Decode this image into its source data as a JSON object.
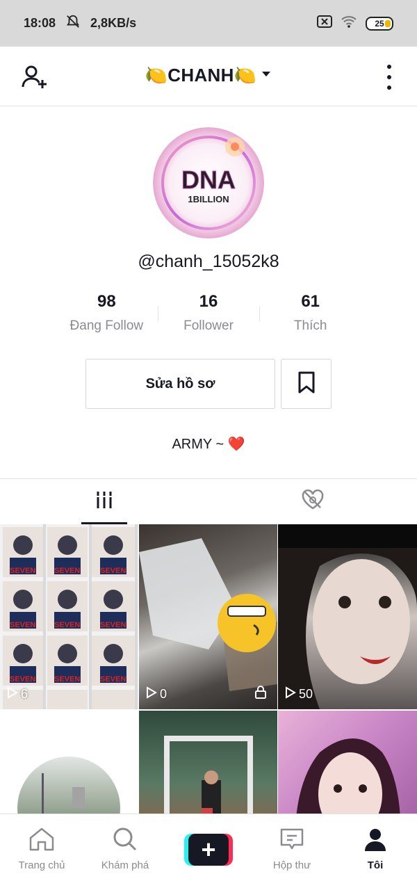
{
  "status_bar": {
    "time": "18:08",
    "speed": "2,8KB/s",
    "battery": "25"
  },
  "header": {
    "title": "🍋CHANH🍋"
  },
  "profile": {
    "avatar_text": "DNA",
    "avatar_subtext": "1BILLION",
    "username": "@chanh_15052k8",
    "stats": {
      "following": {
        "value": "98",
        "label": "Đang Follow"
      },
      "followers": {
        "value": "16",
        "label": "Follower"
      },
      "likes": {
        "value": "61",
        "label": "Thích"
      }
    },
    "edit_button": "Sửa hồ sơ",
    "bio": "ARMY ~ ❤️"
  },
  "videos": [
    {
      "views": "6",
      "locked": false
    },
    {
      "views": "0",
      "locked": true
    },
    {
      "views": "50",
      "locked": false
    },
    {
      "views": "",
      "locked": false
    },
    {
      "views": "",
      "locked": false
    },
    {
      "views": "",
      "locked": false
    }
  ],
  "tile_text": "SEVEN",
  "bottom_nav": {
    "home": "Trang chủ",
    "discover": "Khám phá",
    "inbox": "Hộp thư",
    "me": "Tôi"
  },
  "colors": {
    "text_primary": "#161823",
    "text_secondary": "#8a8b91",
    "accent_red": "#fe2c55",
    "accent_cyan": "#25f4ee"
  }
}
